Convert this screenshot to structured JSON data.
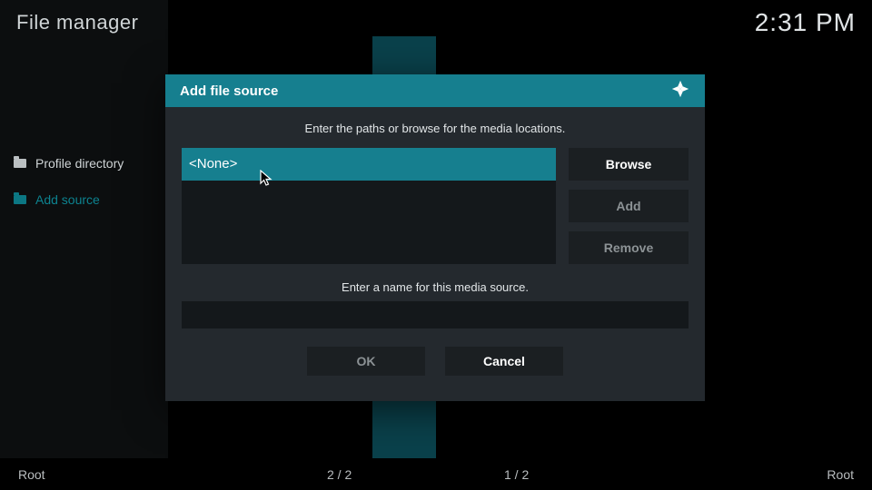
{
  "header": {
    "title": "File manager",
    "clock": "2:31 PM"
  },
  "sidebar": {
    "items": [
      {
        "label": "Profile directory",
        "accent": false
      },
      {
        "label": "Add source",
        "accent": true
      }
    ]
  },
  "statusbar": {
    "left": "Root",
    "mid1": "2 / 2",
    "mid2": "1 / 2",
    "right": "Root"
  },
  "modal": {
    "title": "Add file source",
    "hint_paths": "Enter the paths or browse for the media locations.",
    "path_value": "<None>",
    "buttons": {
      "browse": "Browse",
      "add": "Add",
      "remove": "Remove"
    },
    "hint_name": "Enter a name for this media source.",
    "name_value": "",
    "ok": "OK",
    "cancel": "Cancel"
  }
}
